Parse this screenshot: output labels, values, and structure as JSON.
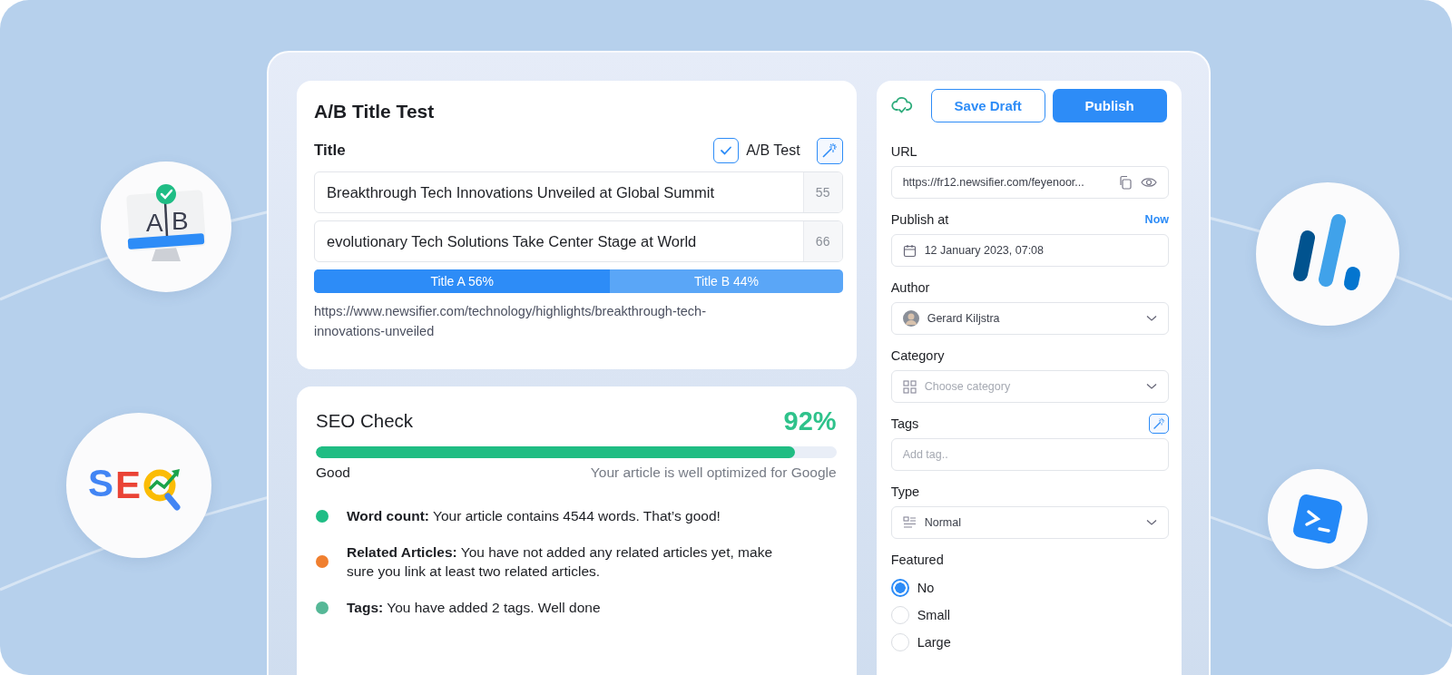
{
  "decor": [
    {
      "kind": "ab",
      "letters": [
        "A",
        "B"
      ]
    },
    {
      "kind": "seo",
      "letters": "SE"
    },
    {
      "kind": "bars"
    },
    {
      "kind": "terminal"
    }
  ],
  "ab_card": {
    "heading": "A/B Title Test",
    "field_label": "Title",
    "ab_test": {
      "label": "A/B Test",
      "checked": true
    },
    "titles": [
      {
        "value": "Breakthrough Tech Innovations Unveiled at Global Summit",
        "count": "55"
      },
      {
        "value": "evolutionary Tech Solutions Take Center Stage at World",
        "count": "66"
      }
    ],
    "split": {
      "level": 0.56,
      "labels": [
        "Title A 56%",
        "Title B 44%"
      ]
    },
    "url": "https://www.newsifier.com/technology/highlights/breakthrough-tech-innovations-unveiled"
  },
  "seo_card": {
    "heading": "SEO Check",
    "score": "92%",
    "level": 0.92,
    "rating": "Good",
    "summary": "Your article is well optimized for Google",
    "checks": [
      {
        "color": "#1fbd85",
        "text": "**Word count:** Your article contains 4544 words. That’s good!"
      },
      {
        "color": "#f07f2f",
        "text": "**Related Articles:** You have not added any related articles yet, make sure you link at least two related articles."
      },
      {
        "color": "#56b897",
        "text": "**Tags:** You have added 2 tags. Well done"
      }
    ]
  },
  "sidebar": {
    "buttons": [
      {
        "label": "Save Draft",
        "kind": "outline"
      },
      {
        "label": "Publish",
        "kind": "primary"
      }
    ],
    "fields": [
      {
        "kind": "url",
        "label": "URL",
        "value": "https://fr12.newsifier.com/feyenoor..."
      },
      {
        "kind": "date",
        "label": "Publish at",
        "action": "Now",
        "value": "12 January 2023, 07:08"
      },
      {
        "kind": "person",
        "label": "Author",
        "value": "Gerard Kiljstra"
      },
      {
        "kind": "category",
        "label": "Category",
        "placeholder": "Choose category"
      },
      {
        "kind": "tags",
        "label": "Tags",
        "placeholder": "Add tag.."
      },
      {
        "kind": "type",
        "label": "Type",
        "value": "Normal"
      }
    ],
    "featured": {
      "label": "Featured",
      "options": [
        {
          "label": "No",
          "selected": true
        },
        {
          "label": "Small",
          "selected": false
        },
        {
          "label": "Large",
          "selected": false
        }
      ]
    }
  }
}
